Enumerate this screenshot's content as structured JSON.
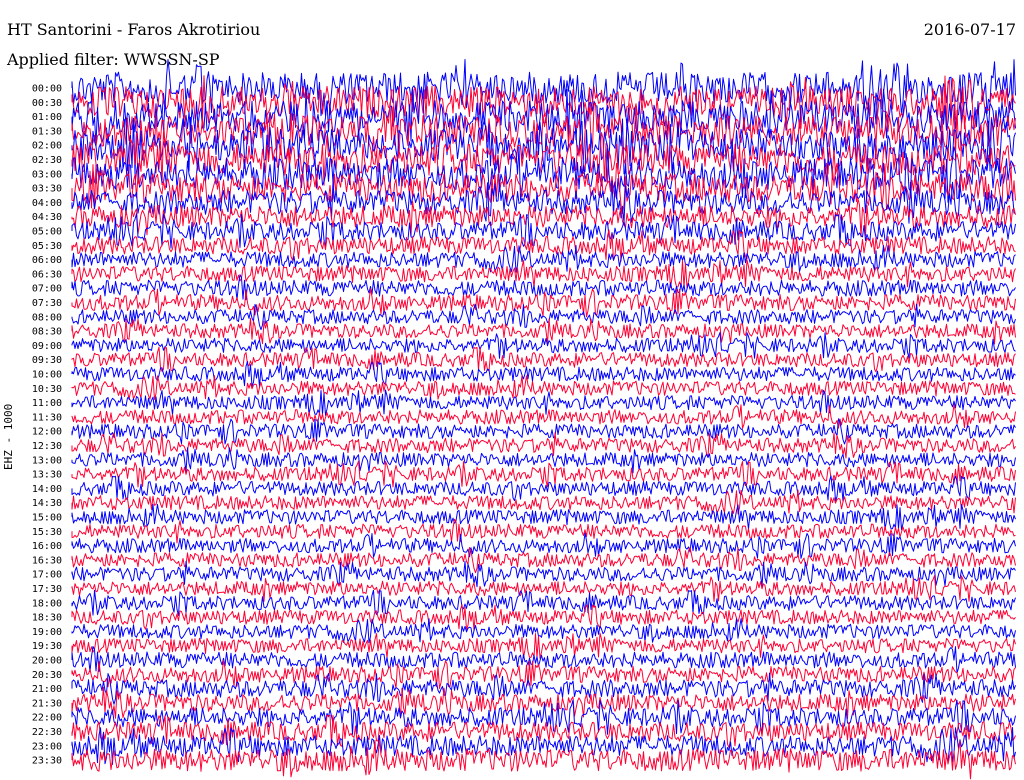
{
  "header": {
    "title": "HT Santorini - Faros Akrotiriou",
    "date": "2016-07-17",
    "filter_label": "Applied filter: WWSSN-SP"
  },
  "axis": {
    "channel_label": "EHZ - 1000"
  },
  "colors": {
    "trace_a": "#0000ff",
    "trace_b": "#ff0033",
    "background": "#ffffff"
  },
  "chart_data": {
    "type": "line",
    "title": "HT Santorini - Faros Akrotiriou",
    "subtitle": "Applied filter: WWSSN-SP",
    "ylabel": "EHZ - 1000",
    "xlabel": "",
    "rows": [
      "00:00",
      "00:30",
      "01:00",
      "01:30",
      "02:00",
      "02:30",
      "03:00",
      "03:30",
      "04:00",
      "04:30",
      "05:00",
      "05:30",
      "06:00",
      "06:30",
      "07:00",
      "07:30",
      "08:00",
      "08:30",
      "09:00",
      "09:30",
      "10:00",
      "10:30",
      "11:00",
      "11:30",
      "12:00",
      "12:30",
      "13:00",
      "13:30",
      "14:00",
      "14:30",
      "15:00",
      "15:30",
      "16:00",
      "16:30",
      "17:00",
      "17:30",
      "18:00",
      "18:30",
      "19:00",
      "19:30",
      "20:00",
      "20:30",
      "21:00",
      "21:30",
      "22:00",
      "22:30",
      "23:00",
      "23:30"
    ],
    "row_colors": [
      "blue",
      "red"
    ],
    "relative_noise_amplitude": [
      1.0,
      1.0,
      1.0,
      1.0,
      1.0,
      1.0,
      1.0,
      0.9,
      0.75,
      0.7,
      0.6,
      0.55,
      0.5,
      0.5,
      0.5,
      0.5,
      0.45,
      0.45,
      0.45,
      0.45,
      0.45,
      0.45,
      0.45,
      0.45,
      0.45,
      0.45,
      0.45,
      0.45,
      0.45,
      0.45,
      0.45,
      0.45,
      0.45,
      0.45,
      0.45,
      0.45,
      0.45,
      0.45,
      0.45,
      0.45,
      0.5,
      0.5,
      0.55,
      0.55,
      0.6,
      0.6,
      0.65,
      0.7
    ],
    "grid": false,
    "legend": "none"
  }
}
